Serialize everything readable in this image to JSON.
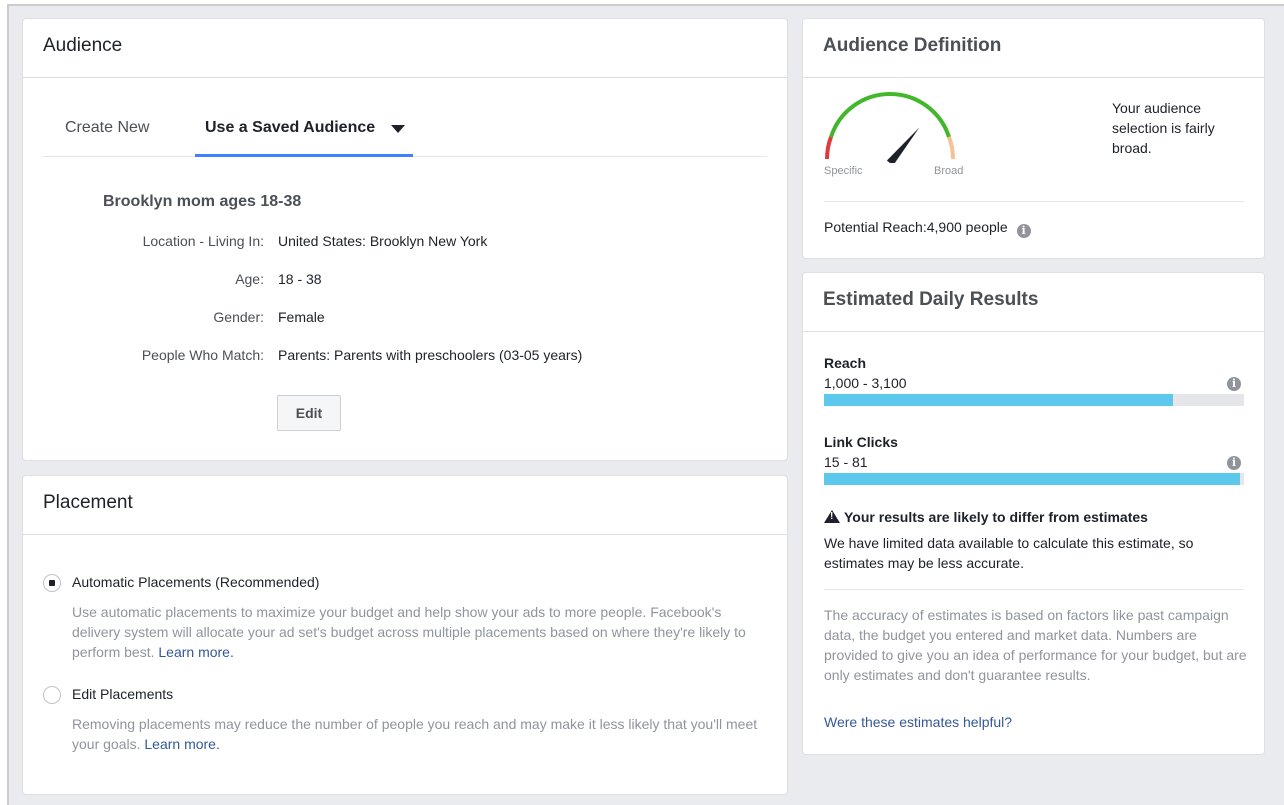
{
  "audience": {
    "title": "Audience",
    "tabs": [
      {
        "label": "Create New"
      },
      {
        "label": "Use a Saved Audience"
      }
    ],
    "saved_name": "Brooklyn mom ages 18-38",
    "fields": [
      {
        "label": "Location - Living In:",
        "value": "United States: Brooklyn New York"
      },
      {
        "label": "Age:",
        "value": "18 - 38"
      },
      {
        "label": "Gender:",
        "value": "Female"
      },
      {
        "label": "People Who Match:",
        "value": "Parents: Parents with preschoolers (03-05 years)"
      }
    ],
    "edit_label": "Edit"
  },
  "placement": {
    "title": "Placement",
    "options": [
      {
        "title": "Automatic Placements (Recommended)",
        "desc": "Use automatic placements to maximize your budget and help show your ads to more people. Facebook's delivery system will allocate your ad set's budget across multiple placements based on where they're likely to perform best.",
        "link": "Learn more.",
        "checked": true
      },
      {
        "title": "Edit Placements",
        "desc": "Removing placements may reduce the number of people you reach and may make it less likely that you'll meet your goals.",
        "link": "Learn more.",
        "checked": false
      }
    ]
  },
  "definition": {
    "title": "Audience Definition",
    "gauge_left": "Specific",
    "gauge_right": "Broad",
    "gauge_level": 0.72,
    "text": "Your audience selection is fairly broad.",
    "reach_label": "Potential Reach:",
    "reach_value": "4,900 people"
  },
  "results": {
    "title": "Estimated Daily Results",
    "metrics": [
      {
        "label": "Reach",
        "value": "1,000 - 3,100",
        "fill": 0.83
      },
      {
        "label": "Link Clicks",
        "value": "15 - 81",
        "fill": 0.99
      }
    ],
    "warning_title": "Your results are likely to differ from estimates",
    "warning_desc": "We have limited data available to calculate this estimate, so estimates may be less accurate.",
    "accuracy_text": "The accuracy of estimates is based on factors like past campaign data, the budget you entered and market data. Numbers are provided to give you an idea of performance for your budget, but are only estimates and don't guarantee results.",
    "helpful_link": "Were these estimates helpful?"
  },
  "icons": {
    "info": "info-icon",
    "warning": "warning-icon",
    "dropdown": "caret-down-icon"
  },
  "colors": {
    "accent": "#4080ff",
    "bar": "#5bc8ec",
    "gauge_green": "#42b72a",
    "gauge_red": "#e0393e",
    "gauge_orange": "#f7c193",
    "link": "#365899"
  }
}
